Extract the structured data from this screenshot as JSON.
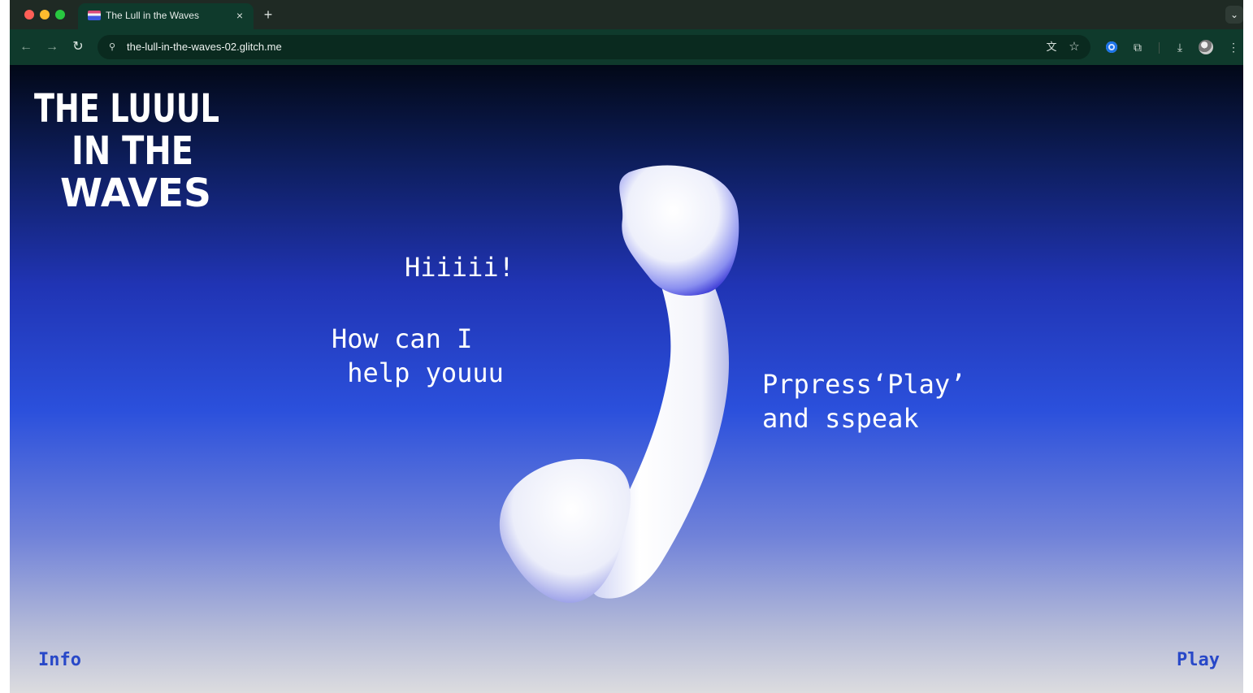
{
  "browser": {
    "tab": {
      "title": "The Lull in the Waves",
      "close_glyph": "×"
    },
    "new_tab_glyph": "+",
    "tab_menu_glyph": "⌄",
    "nav": {
      "back_glyph": "←",
      "forward_glyph": "→",
      "reload_glyph": "↻"
    },
    "omnibox": {
      "url": "the-lull-in-the-waves-02.glitch.me",
      "site_info_glyph": "⚲"
    },
    "icons": [
      "translate-icon",
      "bookmark-star-icon",
      "extension-icon",
      "puzzle-icon",
      "download-icon",
      "profile-avatar-icon",
      "menu-kebab-icon"
    ],
    "glyphs": {
      "translate": "文",
      "star": "☆",
      "puzzle": "⧉",
      "download": "⤓",
      "kebab": "⋮"
    }
  },
  "page": {
    "logo": {
      "line1": "THE LUUUL",
      "line2": "IN THE",
      "line3": "WAVES"
    },
    "greeting": "Hiiiii!",
    "question": "How can I\n help youuu",
    "instruction": "Prpress‘Play’\nand sspeak",
    "info_link": "Info",
    "play_link": "Play"
  },
  "colors": {
    "tab_strip": "#1f2a24",
    "toolbar": "#0f3a2c",
    "link": "#2848c8",
    "gradient": [
      "#020817",
      "#0d1d5a",
      "#2034b4",
      "#2b50dc",
      "#7082d9",
      "#b4bad8",
      "#dcdcdf"
    ]
  }
}
